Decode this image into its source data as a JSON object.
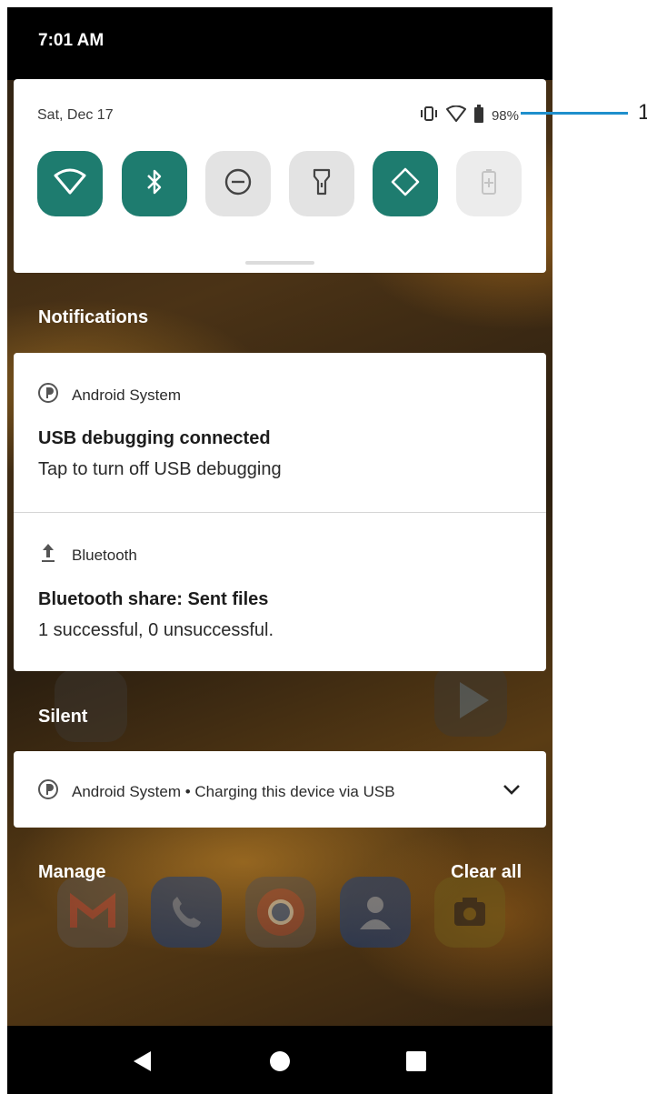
{
  "status_bar": {
    "time": "7:01 AM"
  },
  "quick_settings": {
    "date": "Sat, Dec 17",
    "battery_percent": "98%",
    "tiles": [
      {
        "name": "wifi",
        "state": "on"
      },
      {
        "name": "bluetooth",
        "state": "on"
      },
      {
        "name": "do-not-disturb",
        "state": "off"
      },
      {
        "name": "flashlight",
        "state": "off"
      },
      {
        "name": "auto-rotate",
        "state": "on"
      },
      {
        "name": "battery-saver",
        "state": "unavailable"
      }
    ]
  },
  "notifications": {
    "section_label": "Notifications",
    "items": [
      {
        "app": "Android System",
        "title": "USB debugging connected",
        "text": "Tap to turn off USB debugging"
      },
      {
        "app": "Bluetooth",
        "title": "Bluetooth share: Sent files",
        "text": "1 successful, 0 unsuccessful."
      }
    ]
  },
  "silent": {
    "section_label": "Silent",
    "item": {
      "text": "Android System • Charging this device via USB"
    }
  },
  "footer": {
    "manage": "Manage",
    "clear_all": "Clear all"
  },
  "callout": {
    "number": "1"
  },
  "colors": {
    "tile_on": "#1e7c6f",
    "tile_off": "#e3e3e3",
    "callout_line": "#1f8fcc"
  }
}
